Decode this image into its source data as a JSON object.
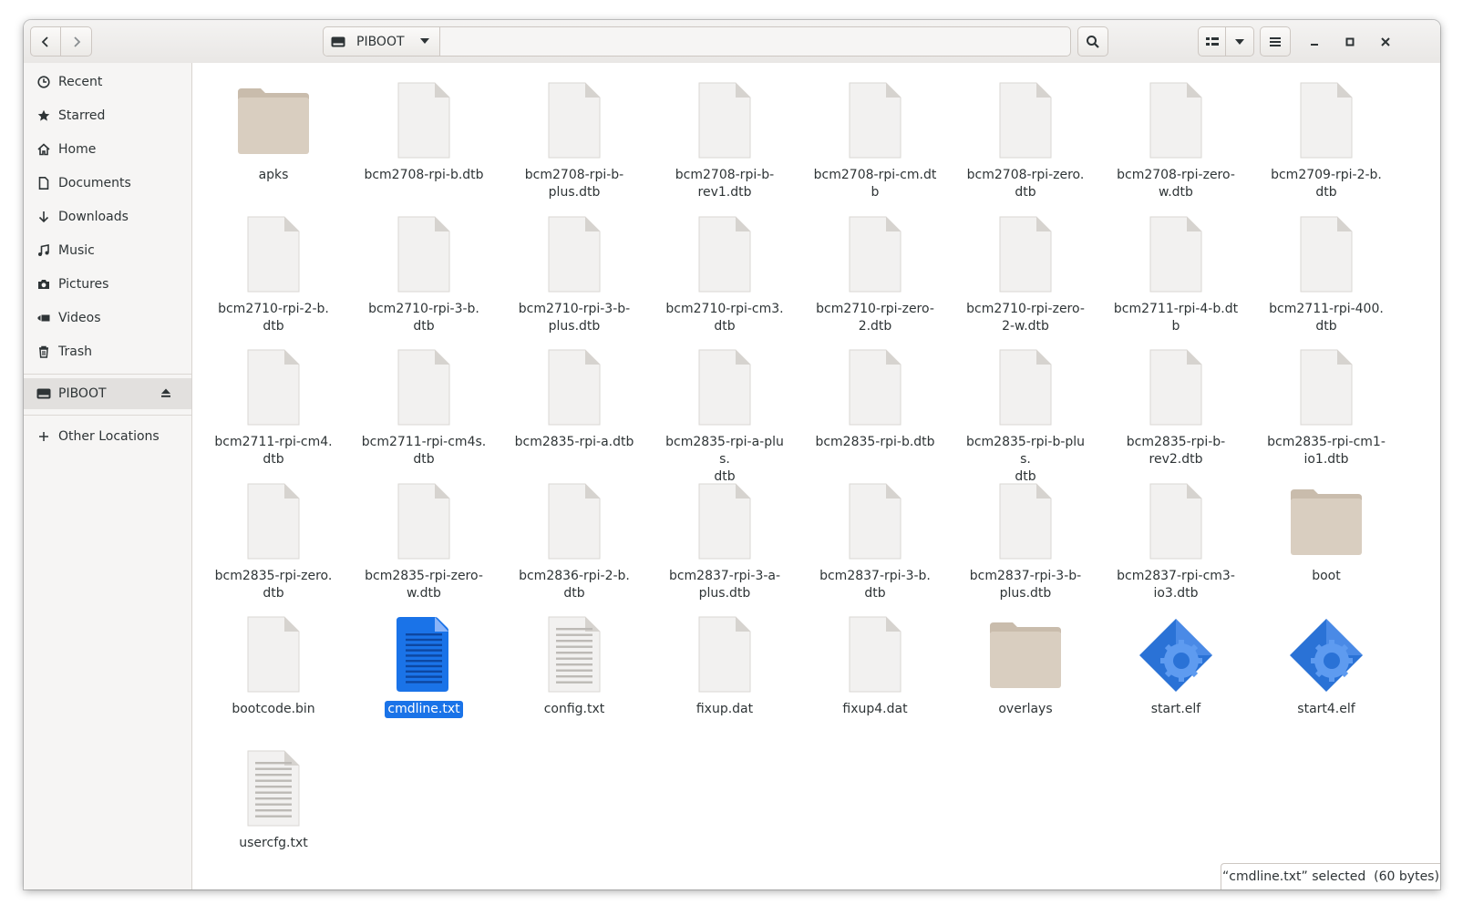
{
  "headerbar": {
    "location_label": "PIBOOT"
  },
  "sidebar": {
    "places": [
      {
        "label": "Recent",
        "icon": "clock-icon"
      },
      {
        "label": "Starred",
        "icon": "star-icon"
      },
      {
        "label": "Home",
        "icon": "home-icon"
      },
      {
        "label": "Documents",
        "icon": "document-icon"
      },
      {
        "label": "Downloads",
        "icon": "download-icon"
      },
      {
        "label": "Music",
        "icon": "music-icon"
      },
      {
        "label": "Pictures",
        "icon": "camera-icon"
      },
      {
        "label": "Videos",
        "icon": "video-icon"
      },
      {
        "label": "Trash",
        "icon": "trash-icon"
      }
    ],
    "device_label": "PIBOOT",
    "other_locations_label": "Other Locations"
  },
  "files": [
    {
      "name": "apks",
      "type": "folder"
    },
    {
      "name": "bcm2708-rpi-b.dtb",
      "type": "file"
    },
    {
      "name": "bcm2708-rpi-b-\nplus.dtb",
      "type": "file"
    },
    {
      "name": "bcm2708-rpi-b-\nrev1.dtb",
      "type": "file"
    },
    {
      "name": "bcm2708-rpi-cm.dtb",
      "type": "file"
    },
    {
      "name": "bcm2708-rpi-zero.\ndtb",
      "type": "file"
    },
    {
      "name": "bcm2708-rpi-zero-\nw.dtb",
      "type": "file"
    },
    {
      "name": "bcm2709-rpi-2-b.\ndtb",
      "type": "file"
    },
    {
      "name": "bcm2710-rpi-2-b.\ndtb",
      "type": "file"
    },
    {
      "name": "bcm2710-rpi-3-b.\ndtb",
      "type": "file"
    },
    {
      "name": "bcm2710-rpi-3-b-\nplus.dtb",
      "type": "file"
    },
    {
      "name": "bcm2710-rpi-cm3.\ndtb",
      "type": "file"
    },
    {
      "name": "bcm2710-rpi-zero-\n2.dtb",
      "type": "file"
    },
    {
      "name": "bcm2710-rpi-zero-\n2-w.dtb",
      "type": "file"
    },
    {
      "name": "bcm2711-rpi-4-b.dtb",
      "type": "file"
    },
    {
      "name": "bcm2711-rpi-400.\ndtb",
      "type": "file"
    },
    {
      "name": "bcm2711-rpi-cm4.\ndtb",
      "type": "file"
    },
    {
      "name": "bcm2711-rpi-cm4s.\ndtb",
      "type": "file"
    },
    {
      "name": "bcm2835-rpi-a.dtb",
      "type": "file"
    },
    {
      "name": "bcm2835-rpi-a-plus.\ndtb",
      "type": "file"
    },
    {
      "name": "bcm2835-rpi-b.dtb",
      "type": "file"
    },
    {
      "name": "bcm2835-rpi-b-plus.\ndtb",
      "type": "file"
    },
    {
      "name": "bcm2835-rpi-b-\nrev2.dtb",
      "type": "file"
    },
    {
      "name": "bcm2835-rpi-cm1-\nio1.dtb",
      "type": "file"
    },
    {
      "name": "bcm2835-rpi-zero.\ndtb",
      "type": "file"
    },
    {
      "name": "bcm2835-rpi-zero-\nw.dtb",
      "type": "file"
    },
    {
      "name": "bcm2836-rpi-2-b.\ndtb",
      "type": "file"
    },
    {
      "name": "bcm2837-rpi-3-a-\nplus.dtb",
      "type": "file"
    },
    {
      "name": "bcm2837-rpi-3-b.\ndtb",
      "type": "file"
    },
    {
      "name": "bcm2837-rpi-3-b-\nplus.dtb",
      "type": "file"
    },
    {
      "name": "bcm2837-rpi-cm3-\nio3.dtb",
      "type": "file"
    },
    {
      "name": "boot",
      "type": "folder"
    },
    {
      "name": "bootcode.bin",
      "type": "file"
    },
    {
      "name": "cmdline.txt",
      "type": "doc-selected"
    },
    {
      "name": "config.txt",
      "type": "text"
    },
    {
      "name": "fixup.dat",
      "type": "file"
    },
    {
      "name": "fixup4.dat",
      "type": "file"
    },
    {
      "name": "overlays",
      "type": "folder"
    },
    {
      "name": "start.elf",
      "type": "exec"
    },
    {
      "name": "start4.elf",
      "type": "exec"
    },
    {
      "name": "usercfg.txt",
      "type": "text"
    }
  ],
  "status": {
    "text": "“cmdline.txt” selected  (60 bytes)"
  },
  "colors": {
    "accent": "#1a73e8",
    "folder": "#d9cec0",
    "exec": "#2a72d6"
  }
}
